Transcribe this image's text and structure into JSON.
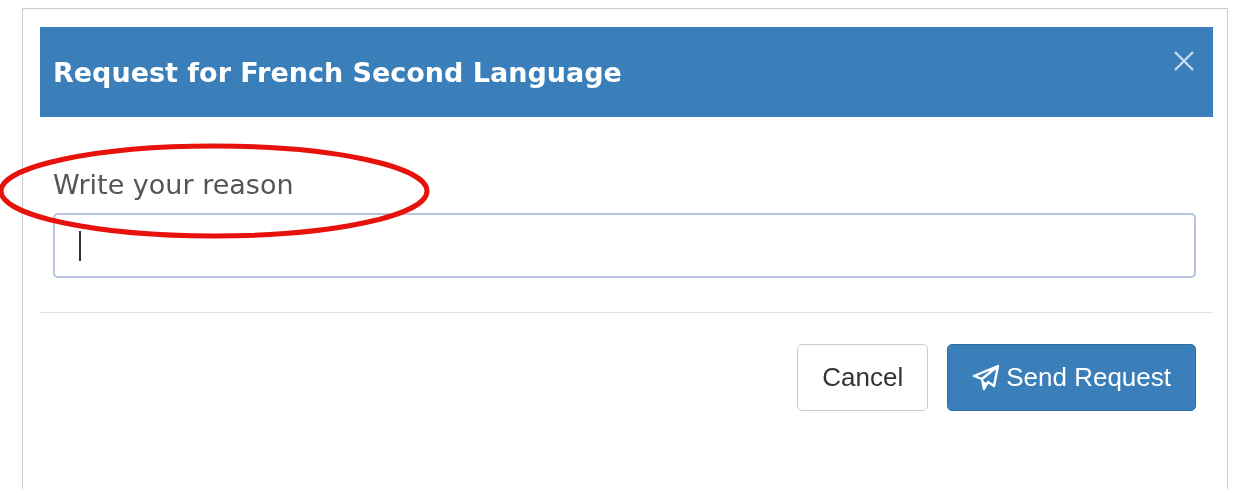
{
  "dialog": {
    "title": "Request for French Second Language",
    "field": {
      "label": "Write your reason"
    },
    "buttons": [
      {
        "label": "Cancel",
        "kind": "secondary"
      },
      {
        "label": "Send Request",
        "kind": "primary"
      }
    ]
  }
}
